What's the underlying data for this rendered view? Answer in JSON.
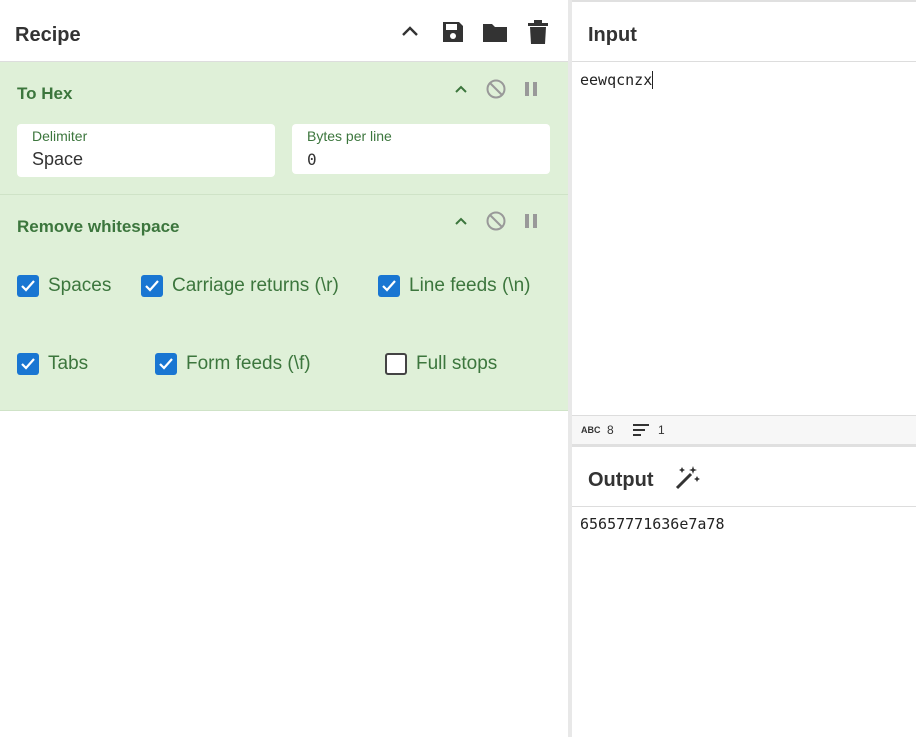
{
  "recipe": {
    "title": "Recipe",
    "icons": [
      "chevron-up-icon",
      "save-icon",
      "folder-icon",
      "trash-icon"
    ],
    "operations": [
      {
        "name": "To Hex",
        "fields": [
          {
            "label": "Delimiter",
            "value": "Space"
          },
          {
            "label": "Bytes per line",
            "value": "0"
          }
        ]
      },
      {
        "name": "Remove whitespace",
        "options": [
          {
            "label": "Spaces",
            "checked": true
          },
          {
            "label": "Carriage returns (\\r)",
            "checked": true
          },
          {
            "label": "Line feeds (\\n)",
            "checked": true
          },
          {
            "label": "Tabs",
            "checked": true
          },
          {
            "label": "Form feeds (\\f)",
            "checked": true
          },
          {
            "label": "Full stops",
            "checked": false
          }
        ]
      }
    ]
  },
  "input": {
    "title": "Input",
    "text": "eewqcnzx",
    "status": {
      "char_count": "8",
      "line_count": "1"
    }
  },
  "output": {
    "title": "Output",
    "text": "65657771636e7a78"
  },
  "colors": {
    "op_bg": "#dff0d8",
    "op_text": "#3c763d",
    "checkbox": "#1976d2"
  }
}
